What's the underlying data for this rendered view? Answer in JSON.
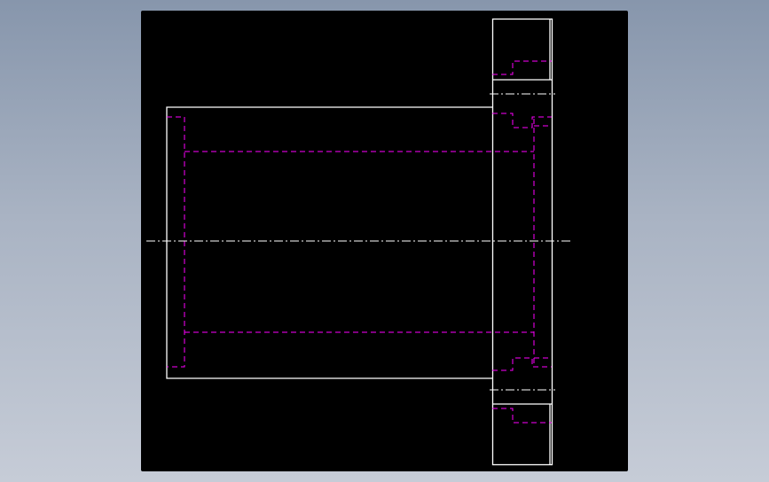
{
  "app": {
    "background_color": "#8f9db1",
    "viewport_color": "#000000"
  },
  "drawing": {
    "view": "side-view",
    "part": "flanged-bushing",
    "colors": {
      "visible_edge": "#ffffff",
      "hidden_edge": "#ff00ff",
      "center_line": "#ffffff"
    },
    "line_styles": {
      "visible_edge": "solid",
      "hidden_edge": "dashed",
      "center_line": "dash-dot"
    }
  }
}
